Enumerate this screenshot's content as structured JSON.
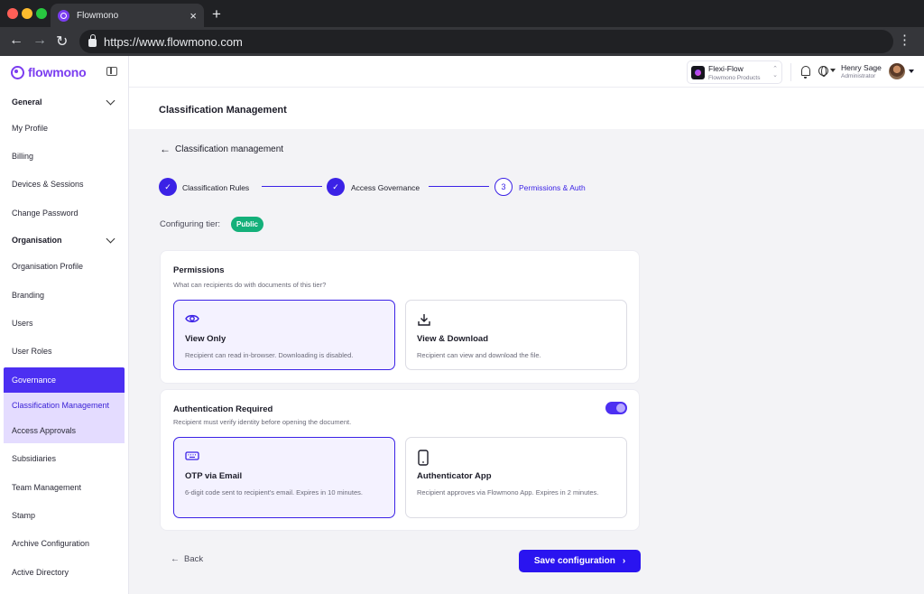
{
  "browser": {
    "tab_title": "Flowmono",
    "url": "https://www.flowmono.com"
  },
  "sidebar": {
    "brand": "flowmono",
    "items": [
      {
        "label": "General",
        "kind": "group"
      },
      {
        "label": "My Profile"
      },
      {
        "label": "Billing"
      },
      {
        "label": "Devices & Sessions"
      },
      {
        "label": "Change Password"
      },
      {
        "label": "Organisation",
        "kind": "group"
      },
      {
        "label": "Organisation Profile"
      },
      {
        "label": "Branding"
      },
      {
        "label": "Users"
      },
      {
        "label": "User Roles"
      },
      {
        "label": "Governance",
        "kind": "active"
      },
      {
        "label": "Classification Management",
        "kind": "sub-current"
      },
      {
        "label": "Access Approvals",
        "kind": "sub"
      },
      {
        "label": "Subsidiaries"
      },
      {
        "label": "Team Management"
      },
      {
        "label": "Stamp"
      },
      {
        "label": "Archive Configuration"
      },
      {
        "label": "Active Directory"
      }
    ]
  },
  "header": {
    "org_name": "Flexi-Flow",
    "org_sub": "Flowmono Products",
    "user_name": "Henry Sage",
    "user_role": "Administrator"
  },
  "page": {
    "title": "Classification Management",
    "back_link": "Classification management",
    "tier_label": "Configuring tier:",
    "tier_value": "Public",
    "tier_color": "#14b07a"
  },
  "stepper": {
    "steps": [
      {
        "label": "Classification Rules",
        "status": "done"
      },
      {
        "label": "Access Governance",
        "status": "done"
      },
      {
        "label": "Permissions & Auth",
        "status": "current",
        "number": "3"
      }
    ]
  },
  "permissions": {
    "title": "Permissions",
    "subtitle": "What can recipients do with documents of this tier?",
    "options": [
      {
        "title": "View Only",
        "desc": "Recipient can read in-browser. Downloading is disabled.",
        "selected": true,
        "icon": "eye-icon"
      },
      {
        "title": "View & Download",
        "desc": "Recipient can view and download the file.",
        "selected": false,
        "icon": "download-icon"
      }
    ]
  },
  "auth": {
    "title": "Authentication Required",
    "subtitle": "Recipient must verify identity before opening the document.",
    "enabled": true,
    "options": [
      {
        "title": "OTP via Email",
        "desc": "6-digit code sent to recipient's email. Expires in 10 minutes.",
        "selected": true,
        "icon": "keyboard-icon"
      },
      {
        "title": "Authenticator App",
        "desc": "Recipient approves via Flowmono App. Expires in 2 minutes.",
        "selected": false,
        "icon": "phone-icon"
      }
    ]
  },
  "actions": {
    "back": "Back",
    "save": "Save configuration"
  },
  "colors": {
    "primary": "#3b22e6",
    "accent": "#7b3df0"
  }
}
